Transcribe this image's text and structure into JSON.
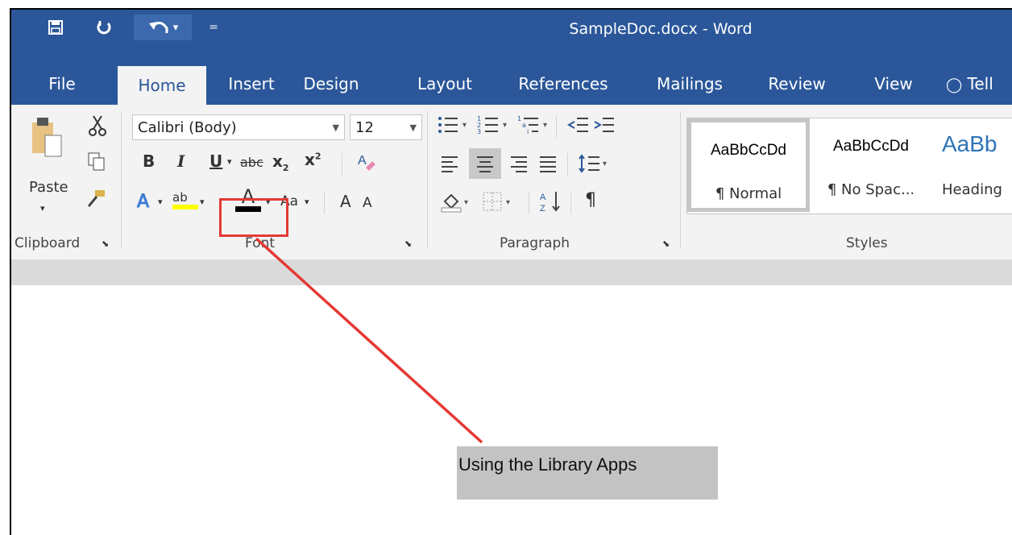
{
  "window": {
    "title": "SampleDoc.docx - Word"
  },
  "quick_access": {
    "save_icon": "save-icon",
    "repeat_icon": "redo-icon",
    "undo_icon": "undo-icon",
    "undo_dropdown": "▾",
    "customize": "="
  },
  "tabs": [
    {
      "label": "File"
    },
    {
      "label": "Home"
    },
    {
      "label": "Insert"
    },
    {
      "label": "Design"
    },
    {
      "label": "Layout"
    },
    {
      "label": "References"
    },
    {
      "label": "Mailings"
    },
    {
      "label": "Review"
    },
    {
      "label": "View"
    },
    {
      "label": "Tell"
    }
  ],
  "clipboard": {
    "paste_label": "Paste",
    "group_label": "Clipboard"
  },
  "font": {
    "font_name": "Calibri (Body)",
    "font_size": "12",
    "bold": "B",
    "italic": "I",
    "underline": "U",
    "strikethrough": "abc",
    "subscript": "x",
    "subscript_mark": "2",
    "superscript": "x",
    "superscript_mark": "2",
    "text_effects": "A",
    "highlight": "ab",
    "font_color": "A",
    "change_case": "Aa",
    "grow_font": "A",
    "shrink_font": "A",
    "group_label": "Font"
  },
  "paragraph": {
    "sort": "A Z",
    "show_marks": "¶",
    "group_label": "Paragraph"
  },
  "styles": {
    "items": [
      {
        "sample": "AaBbCcDd",
        "name": "¶ Normal"
      },
      {
        "sample": "AaBbCcDd",
        "name": "¶ No Spac..."
      },
      {
        "sample": "AaBb",
        "name": "Heading"
      }
    ],
    "group_label": "Styles"
  },
  "annotation": {
    "caption": "Using the Library Apps"
  },
  "colors": {
    "accent": "#2b579a",
    "ribbon_bg": "#f3f3f3",
    "callout": "#e53935",
    "highlight": "#ffff00",
    "font_color_bar": "#000000"
  }
}
